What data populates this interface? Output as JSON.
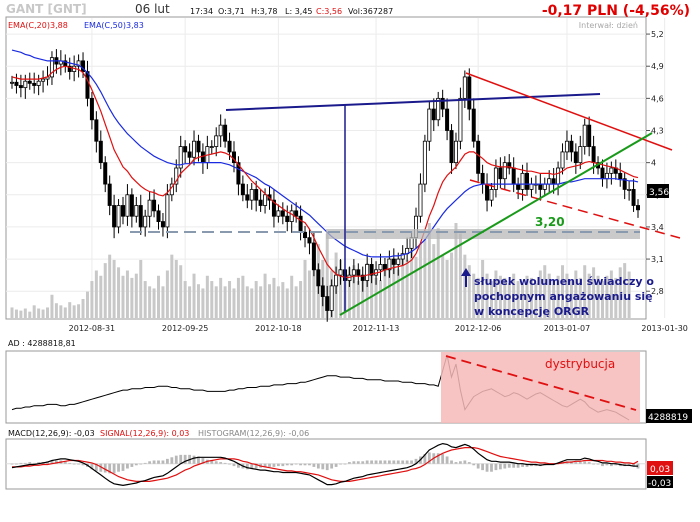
{
  "header": {
    "ticker": "GANT [GNT]",
    "date": "06 lut",
    "time": "17:34",
    "open": "O:3,71",
    "high": "H:3,78",
    "low": "L: 3,45",
    "close": "C:3,56",
    "volume": "Vol:367287",
    "change": "-0,17 PLN (-4,56%)",
    "interval": "Interwał: dzień",
    "ema20_label": "EMA(C,20)3,88",
    "ema50_label": "EMA(C,50)3,83"
  },
  "colors": {
    "candle": "#000000",
    "ema20": "#e01010",
    "ema50": "#1a2be0",
    "volume": "#c8c8c8",
    "resistance": "#1a1a8c",
    "wedge_upper": "#e01010",
    "wedge_lower": "#1a9a1a",
    "support": "#8a9aae",
    "ad_zone": "#f6b9b9",
    "macd": "#000000",
    "signal": "#e01010",
    "histogram": "#b8b8b8",
    "change": "#e00000"
  },
  "chart_data": [
    {
      "type": "candlestick",
      "ylim": [
        2.55,
        5.35
      ],
      "y_ticks": [
        "5,2",
        "4,9",
        "4,6",
        "4,3",
        "4",
        "3,7",
        "3,4",
        "3,1",
        "2,8"
      ],
      "x_ticks": [
        "2012-08-31",
        "2012-09-25",
        "2012-10-18",
        "2012-11-13",
        "2012-12-06",
        "2013-01-07",
        "2013-01-30"
      ],
      "last_price": "3,56",
      "support_value": "3,20",
      "close": [
        4.75,
        4.72,
        4.7,
        4.76,
        4.74,
        4.72,
        4.76,
        4.78,
        4.8,
        4.98,
        4.92,
        4.95,
        4.9,
        4.85,
        4.9,
        4.95,
        4.85,
        4.6,
        4.4,
        4.2,
        4.0,
        3.8,
        3.6,
        3.4,
        3.6,
        3.5,
        3.7,
        3.5,
        3.6,
        3.4,
        3.5,
        3.65,
        3.55,
        3.45,
        3.4,
        3.7,
        3.8,
        3.95,
        4.15,
        4.1,
        4.05,
        4.2,
        4.1,
        4.0,
        4.15,
        4.15,
        4.25,
        4.35,
        4.2,
        4.1,
        4.0,
        3.8,
        3.7,
        3.65,
        3.75,
        3.65,
        3.6,
        3.7,
        3.65,
        3.5,
        3.55,
        3.5,
        3.45,
        3.55,
        3.5,
        3.35,
        3.3,
        3.25,
        3.0,
        2.85,
        2.75,
        2.62,
        2.85,
        2.95,
        3.0,
        2.9,
        2.95,
        3.0,
        2.95,
        2.9,
        3.05,
        2.95,
        3.0,
        3.05,
        3.0,
        3.1,
        3.05,
        3.1,
        3.15,
        3.2,
        3.3,
        3.5,
        3.8,
        4.2,
        4.5,
        4.4,
        4.6,
        4.5,
        4.3,
        4.0,
        4.2,
        4.6,
        4.8,
        4.5,
        4.2,
        3.9,
        3.8,
        3.65,
        3.75,
        3.95,
        3.85,
        4.0,
        3.95,
        3.8,
        3.75,
        3.9,
        3.75,
        3.8,
        3.8,
        3.75,
        3.8,
        3.85,
        3.8,
        3.95,
        4.1,
        4.2,
        4.1,
        4.0,
        4.15,
        4.35,
        4.15,
        4.0,
        3.95,
        3.85,
        3.9,
        3.95,
        3.9,
        3.85,
        3.75,
        3.75,
        3.6,
        3.56
      ],
      "ema20": [
        4.8,
        4.79,
        4.78,
        4.78,
        4.78,
        4.78,
        4.78,
        4.79,
        4.8,
        4.84,
        4.87,
        4.89,
        4.9,
        4.89,
        4.88,
        4.87,
        4.84,
        4.77,
        4.68,
        4.58,
        4.48,
        4.36,
        4.24,
        4.12,
        4.04,
        3.96,
        3.92,
        3.86,
        3.82,
        3.78,
        3.75,
        3.73,
        3.72,
        3.7,
        3.69,
        3.72,
        3.77,
        3.83,
        3.9,
        3.94,
        3.98,
        4.03,
        4.05,
        4.06,
        4.07,
        4.08,
        4.09,
        4.1,
        4.09,
        4.07,
        4.03,
        3.98,
        3.93,
        3.88,
        3.83,
        3.79,
        3.75,
        3.71,
        3.67,
        3.63,
        3.6,
        3.57,
        3.54,
        3.52,
        3.49,
        3.46,
        3.44,
        3.38,
        3.3,
        3.21,
        3.13,
        3.05,
        3.0,
        2.96,
        2.94,
        2.93,
        2.93,
        2.94,
        2.94,
        2.94,
        2.95,
        2.96,
        2.97,
        2.98,
        3.0,
        3.01,
        3.02,
        3.03,
        3.04,
        3.06,
        3.09,
        3.15,
        3.25,
        3.37,
        3.5,
        3.6,
        3.72,
        3.82,
        3.88,
        3.92,
        3.96,
        4.02,
        4.08,
        4.1,
        4.1,
        4.07,
        4.04,
        4.0,
        3.98,
        3.97,
        3.96,
        3.96,
        3.96,
        3.95,
        3.94,
        3.93,
        3.92,
        3.92,
        3.91,
        3.9,
        3.9,
        3.9,
        3.89,
        3.9,
        3.92,
        3.95,
        3.96,
        3.97,
        3.98,
        4.0,
        4.01,
        4.0,
        3.99,
        3.98,
        3.97,
        3.96,
        3.95,
        3.93,
        3.91,
        3.89,
        3.87,
        3.86
      ],
      "ema50": [
        5.05,
        5.04,
        5.03,
        5.01,
        5.0,
        4.98,
        4.97,
        4.96,
        4.95,
        4.95,
        4.95,
        4.95,
        4.94,
        4.93,
        4.92,
        4.91,
        4.88,
        4.84,
        4.79,
        4.73,
        4.66,
        4.58,
        4.5,
        4.43,
        4.37,
        4.32,
        4.27,
        4.23,
        4.19,
        4.15,
        4.12,
        4.09,
        4.06,
        4.04,
        4.02,
        4.0,
        3.99,
        3.98,
        3.98,
        3.99,
        3.99,
        4.0,
        4.0,
        4.0,
        4.0,
        4.0,
        4.0,
        4.0,
        3.99,
        3.98,
        3.96,
        3.94,
        3.92,
        3.9,
        3.88,
        3.86,
        3.83,
        3.8,
        3.78,
        3.75,
        3.72,
        3.69,
        3.66,
        3.63,
        3.6,
        3.57,
        3.54,
        3.51,
        3.47,
        3.43,
        3.39,
        3.35,
        3.31,
        3.28,
        3.25,
        3.22,
        3.2,
        3.18,
        3.16,
        3.14,
        3.13,
        3.12,
        3.12,
        3.12,
        3.12,
        3.12,
        3.13,
        3.13,
        3.14,
        3.15,
        3.17,
        3.2,
        3.24,
        3.28,
        3.34,
        3.4,
        3.46,
        3.52,
        3.57,
        3.61,
        3.65,
        3.69,
        3.73,
        3.76,
        3.78,
        3.79,
        3.8,
        3.8,
        3.8,
        3.8,
        3.8,
        3.8,
        3.8,
        3.8,
        3.8,
        3.8,
        3.8,
        3.8,
        3.8,
        3.8,
        3.8,
        3.8,
        3.8,
        3.8,
        3.81,
        3.82,
        3.82,
        3.83,
        3.84,
        3.85,
        3.85,
        3.85,
        3.85,
        3.85,
        3.85,
        3.85,
        3.85,
        3.84,
        3.84,
        3.83,
        3.83,
        3.82
      ],
      "volume": [
        10,
        8,
        7,
        9,
        6,
        12,
        9,
        8,
        10,
        22,
        14,
        12,
        10,
        15,
        12,
        13,
        18,
        25,
        35,
        45,
        40,
        52,
        60,
        55,
        48,
        40,
        45,
        38,
        42,
        55,
        35,
        30,
        28,
        40,
        30,
        45,
        60,
        55,
        50,
        35,
        30,
        42,
        32,
        28,
        40,
        35,
        30,
        38,
        30,
        35,
        28,
        38,
        40,
        30,
        28,
        35,
        30,
        42,
        32,
        38,
        30,
        34,
        28,
        40,
        30,
        35,
        55,
        45,
        60,
        70,
        55,
        80,
        45,
        62,
        55,
        40,
        48,
        50,
        35,
        40,
        52,
        45,
        38,
        36,
        48,
        50,
        52,
        46,
        60,
        55,
        65,
        58,
        70,
        75,
        90,
        70,
        85,
        60,
        55,
        62,
        90,
        80,
        60,
        50,
        42,
        38,
        55,
        42,
        35,
        45,
        40,
        38,
        33,
        42,
        35,
        32,
        40,
        38,
        33,
        45,
        50,
        42,
        36,
        40,
        50,
        42,
        35,
        45,
        38,
        50,
        42,
        48,
        40,
        35,
        40,
        45,
        38,
        48,
        52,
        44
      ],
      "annotations": {
        "volume_note": [
          "słupek wolumenu świadczy o",
          "pochopnym angażowaniu się",
          "w koncepcję ORGR"
        ]
      }
    },
    {
      "type": "line",
      "name": "AD",
      "legend": "AD : 4288818,81",
      "last_value": "4288819",
      "zone_label": "dystrybucja",
      "values": [
        60,
        59,
        59,
        58,
        58,
        57,
        57,
        57,
        56,
        56,
        56,
        57,
        57,
        56,
        56,
        55,
        54,
        53,
        52,
        51,
        50,
        49,
        48,
        47,
        46,
        45,
        45,
        44,
        44,
        44,
        43,
        43,
        43,
        42,
        42,
        42,
        43,
        43,
        44,
        44,
        44,
        45,
        45,
        45,
        46,
        46,
        46,
        46,
        46,
        45,
        45,
        44,
        44,
        43,
        43,
        43,
        42,
        42,
        42,
        41,
        41,
        41,
        40,
        40,
        40,
        39,
        39,
        38,
        37,
        36,
        35,
        34,
        34,
        34,
        35,
        35,
        35,
        36,
        36,
        36,
        37,
        37,
        37,
        37,
        38,
        38,
        38,
        38,
        39,
        39,
        39,
        40,
        40,
        40,
        41,
        41,
        42,
        30,
        18,
        35,
        25,
        45,
        60,
        55,
        50,
        48,
        46,
        45,
        44,
        46,
        48,
        50,
        49,
        47,
        48,
        50,
        52,
        50,
        48,
        47,
        49,
        51,
        53,
        55,
        57,
        58,
        56,
        54,
        52,
        54,
        58,
        60,
        62,
        61,
        60,
        61,
        62,
        64,
        66,
        68
      ]
    },
    {
      "type": "line",
      "name": "MACD",
      "legend_macd": "MACD(12,26,9): -0,03",
      "legend_signal": "SIGNAL(12,26,9): 0,03",
      "legend_hist": "HISTOGRAM(12,26,9): -0,06",
      "last_signal": "0,03",
      "last_macd": "-0,03",
      "macd": [
        -0.05,
        -0.04,
        -0.03,
        -0.02,
        -0.01,
        -0.01,
        0.0,
        0.01,
        0.02,
        0.04,
        0.05,
        0.06,
        0.06,
        0.05,
        0.04,
        0.03,
        0.01,
        -0.02,
        -0.06,
        -0.1,
        -0.14,
        -0.18,
        -0.22,
        -0.25,
        -0.26,
        -0.27,
        -0.26,
        -0.25,
        -0.24,
        -0.22,
        -0.21,
        -0.19,
        -0.17,
        -0.16,
        -0.15,
        -0.12,
        -0.08,
        -0.04,
        0.0,
        0.03,
        0.05,
        0.07,
        0.08,
        0.08,
        0.08,
        0.08,
        0.08,
        0.08,
        0.07,
        0.05,
        0.03,
        0.0,
        -0.03,
        -0.05,
        -0.06,
        -0.07,
        -0.08,
        -0.08,
        -0.09,
        -0.1,
        -0.1,
        -0.11,
        -0.11,
        -0.11,
        -0.11,
        -0.12,
        -0.13,
        -0.14,
        -0.17,
        -0.2,
        -0.23,
        -0.26,
        -0.26,
        -0.25,
        -0.23,
        -0.22,
        -0.2,
        -0.18,
        -0.17,
        -0.16,
        -0.14,
        -0.13,
        -0.12,
        -0.11,
        -0.1,
        -0.09,
        -0.08,
        -0.07,
        -0.06,
        -0.05,
        -0.03,
        0.0,
        0.05,
        0.11,
        0.17,
        0.2,
        0.23,
        0.25,
        0.24,
        0.21,
        0.2,
        0.22,
        0.24,
        0.22,
        0.18,
        0.13,
        0.09,
        0.05,
        0.03,
        0.03,
        0.02,
        0.02,
        0.02,
        0.01,
        0.0,
        0.0,
        -0.01,
        -0.01,
        -0.01,
        -0.02,
        -0.01,
        -0.01,
        -0.01,
        0.01,
        0.03,
        0.05,
        0.05,
        0.05,
        0.05,
        0.07,
        0.06,
        0.04,
        0.03,
        0.01,
        0.01,
        0.0,
        0.0,
        -0.01,
        -0.02,
        -0.02,
        -0.03,
        -0.03
      ],
      "signal": [
        -0.04,
        -0.04,
        -0.04,
        -0.03,
        -0.03,
        -0.02,
        -0.02,
        -0.01,
        -0.01,
        0.0,
        0.01,
        0.02,
        0.03,
        0.04,
        0.04,
        0.04,
        0.03,
        0.02,
        0.01,
        -0.01,
        -0.04,
        -0.07,
        -0.1,
        -0.13,
        -0.16,
        -0.18,
        -0.2,
        -0.21,
        -0.22,
        -0.22,
        -0.22,
        -0.22,
        -0.21,
        -0.2,
        -0.19,
        -0.18,
        -0.16,
        -0.14,
        -0.11,
        -0.08,
        -0.06,
        -0.03,
        -0.01,
        0.01,
        0.03,
        0.04,
        0.05,
        0.06,
        0.06,
        0.06,
        0.06,
        0.05,
        0.03,
        0.02,
        0.0,
        -0.01,
        -0.03,
        -0.04,
        -0.05,
        -0.06,
        -0.07,
        -0.08,
        -0.09,
        -0.09,
        -0.1,
        -0.1,
        -0.11,
        -0.12,
        -0.13,
        -0.14,
        -0.16,
        -0.18,
        -0.2,
        -0.21,
        -0.22,
        -0.22,
        -0.22,
        -0.21,
        -0.2,
        -0.19,
        -0.18,
        -0.17,
        -0.16,
        -0.15,
        -0.14,
        -0.13,
        -0.12,
        -0.11,
        -0.1,
        -0.09,
        -0.07,
        -0.06,
        -0.04,
        -0.01,
        0.03,
        0.07,
        0.1,
        0.13,
        0.15,
        0.17,
        0.18,
        0.19,
        0.2,
        0.2,
        0.2,
        0.19,
        0.17,
        0.15,
        0.13,
        0.11,
        0.09,
        0.08,
        0.07,
        0.06,
        0.05,
        0.04,
        0.03,
        0.02,
        0.02,
        0.01,
        0.01,
        0.0,
        0.0,
        0.0,
        0.01,
        0.02,
        0.02,
        0.03,
        0.03,
        0.04,
        0.04,
        0.04,
        0.04,
        0.04,
        0.03,
        0.03,
        0.02,
        0.02,
        0.01,
        0.01,
        0.0,
        0.03
      ]
    }
  ]
}
